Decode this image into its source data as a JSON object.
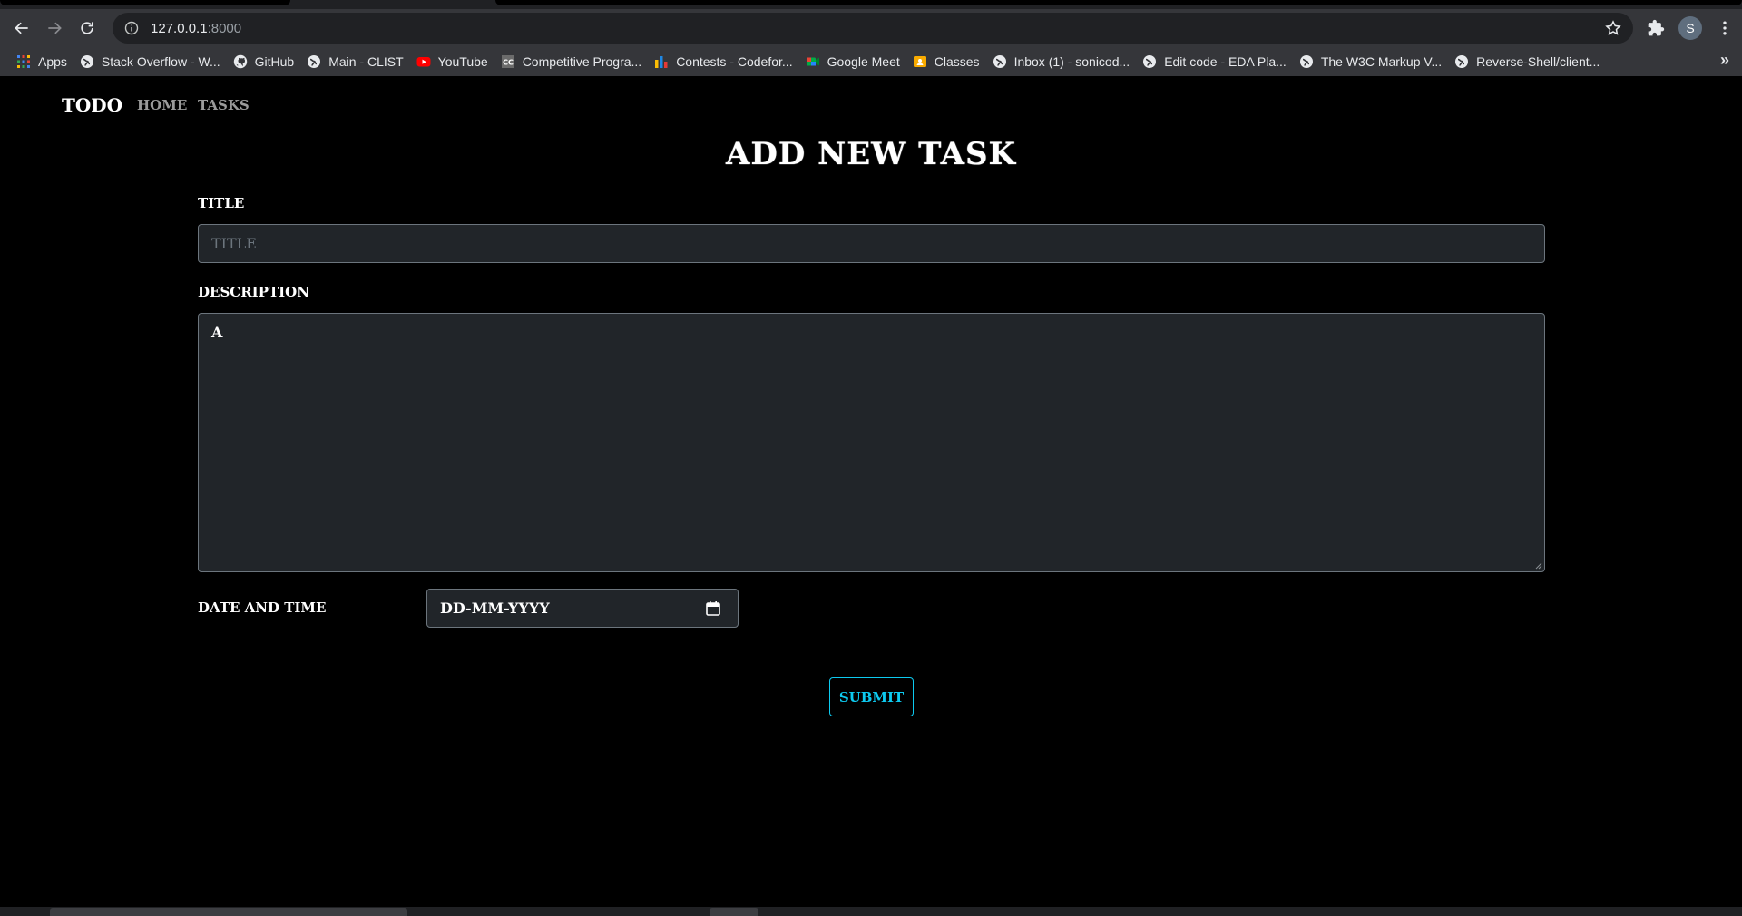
{
  "browser": {
    "url_host": "127.0.0.1",
    "url_port": ":8000",
    "profile_initial": "S",
    "bookmarks": [
      {
        "label": "Apps",
        "icon": "apps-grid-icon"
      },
      {
        "label": "Stack Overflow - W...",
        "icon": "globe-icon"
      },
      {
        "label": "GitHub",
        "icon": "github-icon"
      },
      {
        "label": "Main - CLIST",
        "icon": "globe-icon"
      },
      {
        "label": "YouTube",
        "icon": "youtube-icon"
      },
      {
        "label": "Competitive Progra...",
        "icon": "cc-icon"
      },
      {
        "label": "Contests - Codefor...",
        "icon": "codeforces-icon"
      },
      {
        "label": "Google Meet",
        "icon": "meet-icon"
      },
      {
        "label": "Classes",
        "icon": "classroom-icon"
      },
      {
        "label": "Inbox (1) - sonicod...",
        "icon": "globe-icon"
      },
      {
        "label": "Edit code - EDA Pla...",
        "icon": "globe-icon"
      },
      {
        "label": "The W3C Markup V...",
        "icon": "globe-icon"
      },
      {
        "label": "Reverse-Shell/client...",
        "icon": "globe-icon"
      }
    ],
    "more_label": "»"
  },
  "navbar": {
    "brand": "TODO",
    "links": [
      "HOME",
      "TASKS"
    ]
  },
  "form": {
    "heading": "ADD NEW TASK",
    "title_label": "TITLE",
    "title_placeholder": "TITLE",
    "title_value": "",
    "description_label": "DESCRIPTION",
    "description_value": "A",
    "datetime_label": "DATE AND TIME",
    "datetime_value": "DD-MM-YYYY",
    "submit_label": "SUBMIT"
  },
  "colors": {
    "page_background": "#000000",
    "input_background": "#212529",
    "submit_accent": "#0dcaf0",
    "nav_link": "#9a9a9a"
  }
}
